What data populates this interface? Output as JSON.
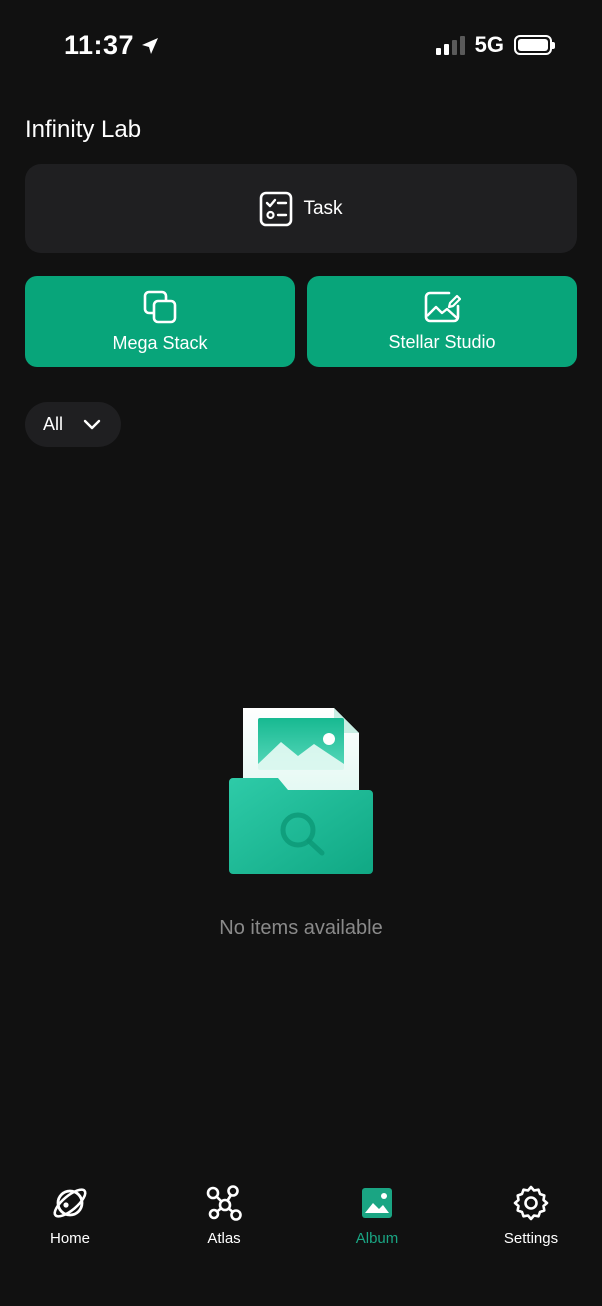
{
  "status": {
    "time": "11:37",
    "network": "5G",
    "signal_bars_active": 2,
    "signal_bars_total": 4
  },
  "header": {
    "title": "Infinity Lab"
  },
  "task_card": {
    "label": "Task",
    "icon": "checklist-icon"
  },
  "actions": [
    {
      "label": "Mega Stack",
      "icon": "stack-icon"
    },
    {
      "label": "Stellar Studio",
      "icon": "image-edit-icon"
    }
  ],
  "filter": {
    "selected": "All",
    "icon": "chevron-down-icon"
  },
  "empty_state": {
    "message": "No items available",
    "icon": "folder-search-illustration"
  },
  "tabs": [
    {
      "label": "Home",
      "icon": "planet-icon",
      "active": false
    },
    {
      "label": "Atlas",
      "icon": "network-icon",
      "active": false
    },
    {
      "label": "Album",
      "icon": "album-icon",
      "active": true
    },
    {
      "label": "Settings",
      "icon": "gear-icon",
      "active": false
    }
  ],
  "colors": {
    "background": "#111111",
    "card": "#1f1f21",
    "accent": "#08a57a",
    "active_tab": "#1aa583",
    "muted_text": "#8a8a8a"
  }
}
